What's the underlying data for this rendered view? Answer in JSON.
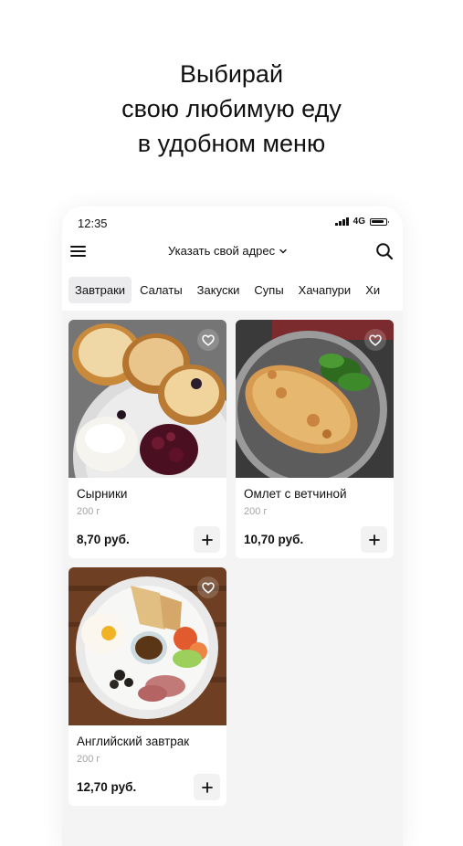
{
  "headline": {
    "line1": "Выбирай",
    "line2": "свою любимую еду",
    "line3": "в удобном меню"
  },
  "status_bar": {
    "time": "12:35",
    "network": "4G"
  },
  "header": {
    "address_label": "Указать свой адрес",
    "menu_icon": "hamburger-menu-icon",
    "search_icon": "search-icon",
    "address_chevron_icon": "chevron-down-icon"
  },
  "tabs": [
    {
      "label": "Завтраки",
      "active": true
    },
    {
      "label": "Салаты",
      "active": false
    },
    {
      "label": "Закуски",
      "active": false
    },
    {
      "label": "Супы",
      "active": false
    },
    {
      "label": "Хачапури",
      "active": false
    },
    {
      "label": "Хи",
      "active": false
    }
  ],
  "products": [
    {
      "name": "Сырники",
      "weight": "200 г",
      "price": "8,70 руб.",
      "add_label": "+",
      "fav_icon": "heart-icon"
    },
    {
      "name": "Омлет с ветчиной",
      "weight": "200 г",
      "price": "10,70 руб.",
      "add_label": "+",
      "fav_icon": "heart-icon"
    },
    {
      "name": "Английский завтрак",
      "weight": "200 г",
      "price": "12,70 руб.",
      "add_label": "+",
      "fav_icon": "heart-icon"
    }
  ],
  "colors": {
    "page_background": "#ffffff",
    "app_background": "#f4f4f5",
    "active_tab": "#ececee",
    "muted_text": "#a4a4a8"
  }
}
